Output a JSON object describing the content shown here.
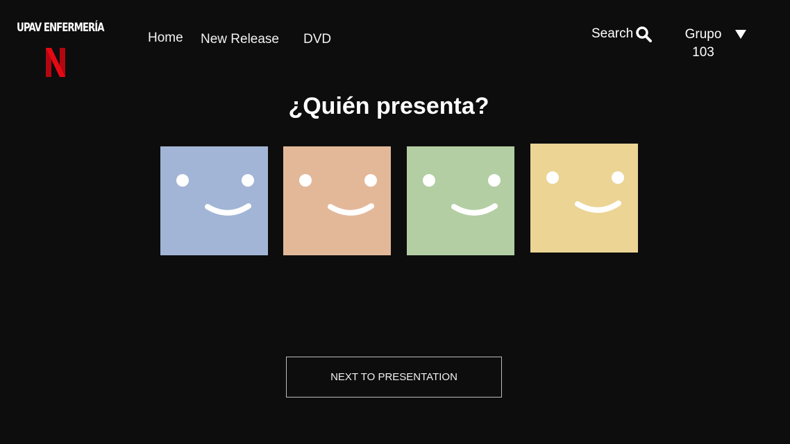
{
  "header": {
    "brand_text": "UPAV ENFERMERÍA",
    "logo_icon": "netflix-n-logo",
    "nav": [
      {
        "label": "Home"
      },
      {
        "label": "New Release"
      },
      {
        "label": "DVD"
      }
    ],
    "search_label": "Search",
    "account": {
      "line1": "Grupo",
      "line2": "103"
    }
  },
  "main": {
    "title": "¿Quién presenta?",
    "profiles": [
      {
        "color": "#a2b5d6",
        "icon": "smiley-face-icon"
      },
      {
        "color": "#e3b899",
        "icon": "smiley-face-icon"
      },
      {
        "color": "#b3cea3",
        "icon": "smiley-face-icon"
      },
      {
        "color": "#ebd494",
        "icon": "smiley-face-icon"
      }
    ],
    "next_button": "NEXT TO PRESENTATION"
  },
  "colors": {
    "background": "#0d0d0d",
    "netflix_red": "#e50914"
  }
}
